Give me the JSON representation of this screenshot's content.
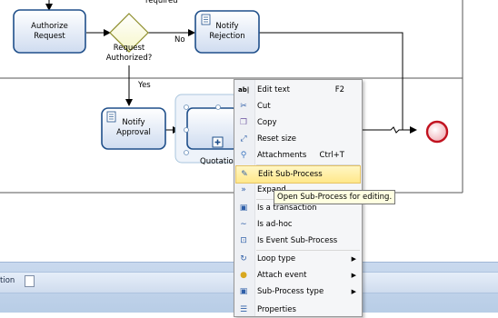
{
  "diagram": {
    "tasks": {
      "authorize_request": [
        "Authorize",
        "Request"
      ],
      "notify_rejection": [
        "Notify",
        "Rejection"
      ],
      "notify_approval": [
        "Notify",
        "Approval"
      ]
    },
    "gateway_label": [
      "Request",
      "Authorized?"
    ],
    "top_label": "required",
    "flow_no": "No",
    "flow_yes": "Yes",
    "subprocess_label": "Quotation"
  },
  "bottom_panel": {
    "tab_label": "tion"
  },
  "context_menu": {
    "items": [
      {
        "label": "Edit text",
        "shortcut": "F2",
        "icon": "edit-text-icon"
      },
      {
        "label": "Cut",
        "shortcut": "",
        "icon": "cut-icon"
      },
      {
        "label": "Copy",
        "shortcut": "",
        "icon": "copy-icon"
      },
      {
        "label": "Reset size",
        "shortcut": "",
        "icon": "reset-size-icon"
      },
      {
        "label": "Attachments",
        "shortcut": "Ctrl+T",
        "icon": "attachments-icon"
      },
      {
        "label": "Edit Sub-Process",
        "shortcut": "",
        "icon": "edit-subprocess-icon"
      },
      {
        "label": "Expand",
        "shortcut": "",
        "icon": "expand-icon"
      },
      {
        "label": "Is a transaction",
        "shortcut": "",
        "icon": "transaction-icon"
      },
      {
        "label": "Is ad-hoc",
        "shortcut": "",
        "icon": "ad-hoc-icon"
      },
      {
        "label": "Is Event Sub-Process",
        "shortcut": "",
        "icon": "event-subprocess-icon"
      },
      {
        "label": "Loop type",
        "shortcut": "",
        "icon": "loop-icon"
      },
      {
        "label": "Attach event",
        "shortcut": "",
        "icon": "attach-event-icon"
      },
      {
        "label": "Sub-Process type",
        "shortcut": "",
        "icon": "subprocess-type-icon"
      },
      {
        "label": "Properties",
        "shortcut": "",
        "icon": "properties-icon"
      }
    ],
    "highlighted_index": 5
  },
  "tooltip": "Open Sub-Process for editing.",
  "colors": {
    "task_fill": "#dfe8f6",
    "task_stroke": "#1f4f8a",
    "gateway_fill": "#fefee0",
    "end_event_fill": "#f2b8be",
    "end_event_stroke": "#c1121f",
    "menu_highlight": "#ffe88a"
  }
}
